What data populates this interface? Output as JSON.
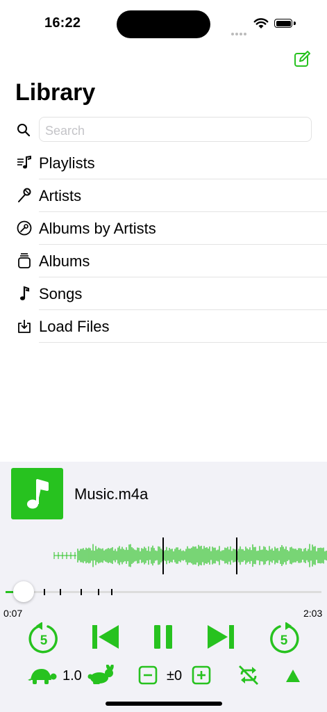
{
  "status_bar": {
    "time": "16:22"
  },
  "header": {
    "title": "Library",
    "compose_icon": "compose-icon"
  },
  "search": {
    "placeholder": "Search"
  },
  "library_items": [
    {
      "label": "Playlists",
      "icon": "playlist-icon"
    },
    {
      "label": "Artists",
      "icon": "microphone-icon"
    },
    {
      "label": "Albums by Artists",
      "icon": "album-disc-icon"
    },
    {
      "label": "Albums",
      "icon": "album-stack-icon"
    },
    {
      "label": "Songs",
      "icon": "music-note-icon"
    },
    {
      "label": "Load Files",
      "icon": "download-icon"
    }
  ],
  "player": {
    "track_title": "Music.m4a",
    "current_time": "0:07",
    "total_time": "2:03",
    "progress": 0.057,
    "skip_seconds_back": "5",
    "skip_seconds_forward": "5",
    "rate": "1.0",
    "pitch": "±0"
  },
  "colors": {
    "accent": "#27c21f",
    "background": "#ffffff",
    "player_bg": "#f2f2f7"
  }
}
